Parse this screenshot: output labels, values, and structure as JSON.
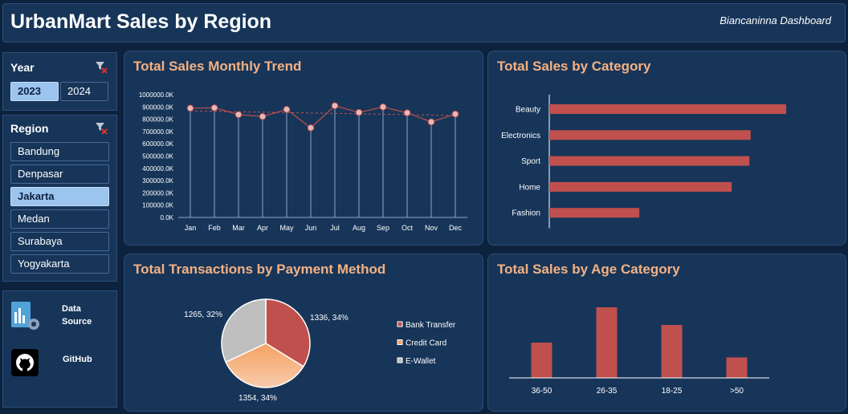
{
  "header": {
    "title": "UrbanMart Sales by Region",
    "subtitle": "Biancaninna Dashboard"
  },
  "slicers": {
    "year": {
      "title": "Year",
      "options": [
        "2023",
        "2024"
      ],
      "selected": "2023"
    },
    "region": {
      "title": "Region",
      "options": [
        "Bandung",
        "Denpasar",
        "Jakarta",
        "Medan",
        "Surabaya",
        "Yogyakarta"
      ],
      "selected": "Jakarta"
    }
  },
  "links": {
    "data_source": "Data Source",
    "github": "GitHub"
  },
  "colors": {
    "bar": "#c0504d",
    "line": "#c0504d",
    "marker": "#e6b9b8",
    "title": "#f4b183",
    "panel": "#173559",
    "background": "#0d223d",
    "pie": [
      "#c0504d",
      "#f4a261",
      "#bfbfbf"
    ]
  },
  "chart_data": [
    {
      "type": "line",
      "title": "Total Sales Monthly Trend",
      "categories": [
        "Jan",
        "Feb",
        "Mar",
        "Apr",
        "May",
        "Jun",
        "Jul",
        "Aug",
        "Sep",
        "Oct",
        "Nov",
        "Dec"
      ],
      "values": [
        890000,
        893000,
        838000,
        822000,
        880000,
        730000,
        910000,
        855000,
        900000,
        852000,
        778000,
        842000
      ],
      "trendline": true,
      "ylim": [
        0,
        1000000
      ],
      "yticks": [
        "0.0K",
        "100000.0K",
        "200000.0K",
        "300000.0K",
        "400000.0K",
        "500000.0K",
        "600000.0K",
        "700000.0K",
        "800000.0K",
        "900000.0K",
        "1000000.0K"
      ]
    },
    {
      "type": "bar",
      "orientation": "horizontal",
      "title": "Total Sales by Category",
      "categories": [
        "Beauty",
        "Electronics",
        "Sport",
        "Home",
        "Fashion"
      ],
      "values": [
        100,
        85,
        84.5,
        77,
        38
      ]
    },
    {
      "type": "pie",
      "title": "Total Transactions by Payment Method",
      "labels": [
        "Bank Transfer",
        "Credit Card",
        "E-Wallet"
      ],
      "values": [
        1336,
        1354,
        1265
      ],
      "percents": [
        "34%",
        "34%",
        "32%"
      ],
      "data_labels": [
        "1336, 34%",
        "1354, 34%",
        "1265, 32%"
      ]
    },
    {
      "type": "bar",
      "title": "Total Sales by Age Category",
      "categories": [
        "36-50",
        "26-35",
        "18-25",
        ">50"
      ],
      "values": [
        50,
        100,
        75,
        29
      ]
    }
  ]
}
